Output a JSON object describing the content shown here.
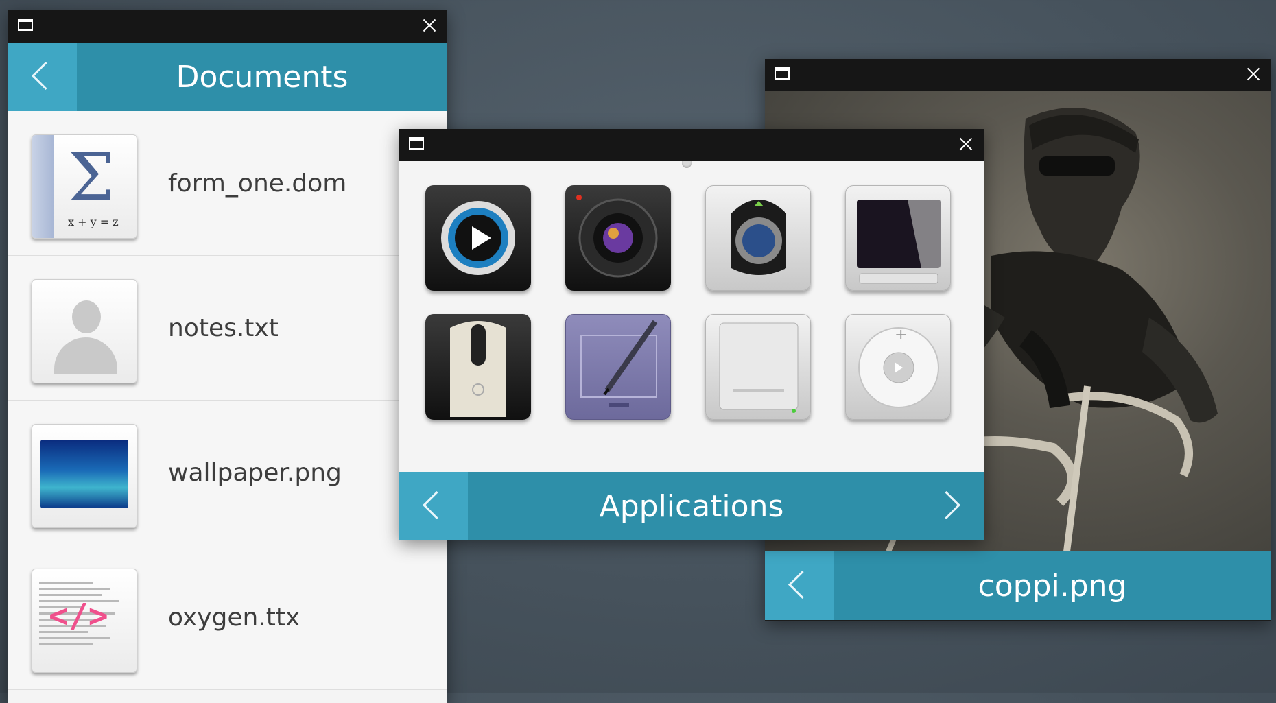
{
  "documents_window": {
    "title": "Documents",
    "files": [
      {
        "name": "form_one.dom",
        "icon": "formula-icon",
        "formula": "x + y = z"
      },
      {
        "name": "notes.txt",
        "icon": "contact-icon"
      },
      {
        "name": "wallpaper.png",
        "icon": "image-icon"
      },
      {
        "name": "oxygen.ttx",
        "icon": "code-file-icon",
        "code_symbol": "</>"
      }
    ]
  },
  "applications_window": {
    "title": "Applications",
    "apps": [
      {
        "icon": "media-player-icon"
      },
      {
        "icon": "camera-icon"
      },
      {
        "icon": "webcam-icon"
      },
      {
        "icon": "tablet-device-icon"
      },
      {
        "icon": "mouse-icon"
      },
      {
        "icon": "drawing-tablet-icon"
      },
      {
        "icon": "external-drive-icon"
      },
      {
        "icon": "music-player-icon"
      }
    ]
  },
  "photo_window": {
    "title": "coppi.png",
    "image": "cyclist-photo"
  },
  "colors": {
    "header": "#2e8fa9",
    "header_back": "#3fa7c4",
    "titlebar": "#161616",
    "desktop": "#4b5761"
  }
}
